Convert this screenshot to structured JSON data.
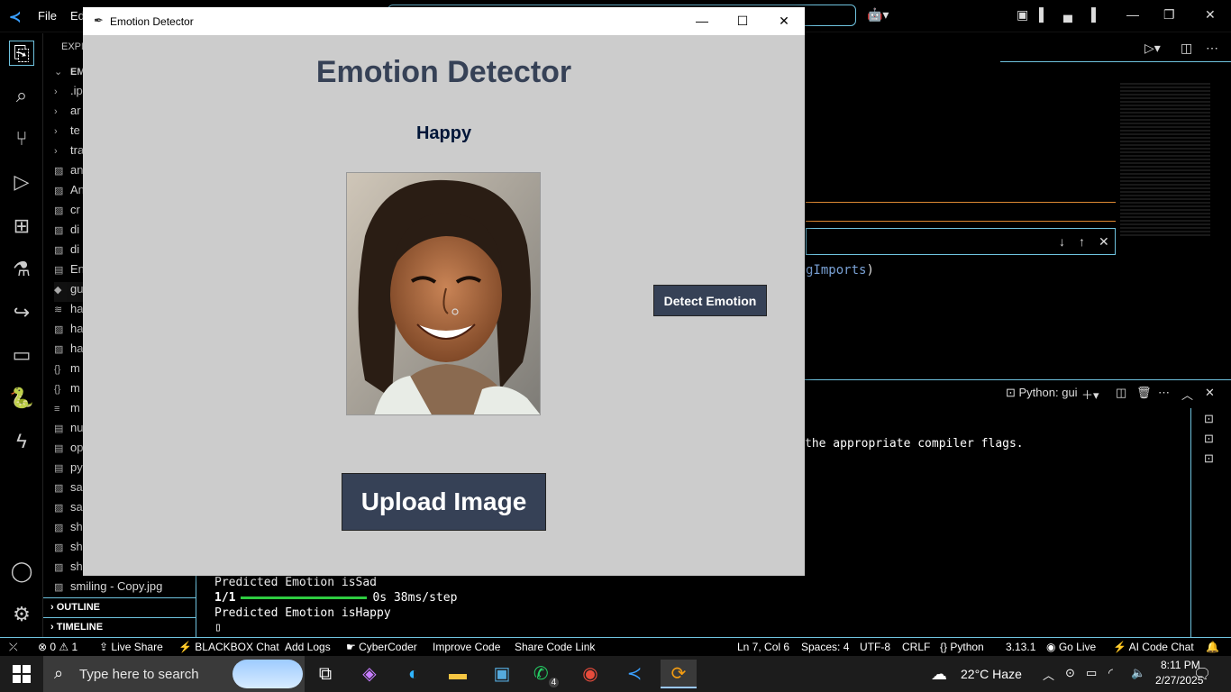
{
  "vscode": {
    "menu": [
      "File",
      "Ed"
    ],
    "explorer_header": "EXPLO",
    "explorer_root": "EMOT",
    "sidebar_items": [
      {
        "icon": "chevron-right-icon",
        "label": ".ip"
      },
      {
        "icon": "chevron-right-icon",
        "label": "ar"
      },
      {
        "icon": "chevron-right-icon",
        "label": "te"
      },
      {
        "icon": "chevron-right-icon",
        "label": "tra"
      },
      {
        "icon": "image-file-icon",
        "label": "an"
      },
      {
        "icon": "image-file-icon",
        "label": "An"
      },
      {
        "icon": "image-file-icon",
        "label": "cr"
      },
      {
        "icon": "image-file-icon",
        "label": "di"
      },
      {
        "icon": "image-file-icon",
        "label": "di"
      },
      {
        "icon": "file-icon",
        "label": "En"
      },
      {
        "icon": "python-file-icon",
        "label": "gu"
      },
      {
        "icon": "rss-icon",
        "label": "ha"
      },
      {
        "icon": "image-file-icon",
        "label": "ha"
      },
      {
        "icon": "image-file-icon",
        "label": "ha"
      },
      {
        "icon": "json-file-icon",
        "label": "m"
      },
      {
        "icon": "json-file-icon",
        "label": "m"
      },
      {
        "icon": "text-file-icon",
        "label": "m"
      },
      {
        "icon": "file-icon",
        "label": "nu"
      },
      {
        "icon": "file-icon",
        "label": "op"
      },
      {
        "icon": "file-icon",
        "label": "py"
      },
      {
        "icon": "image-file-icon",
        "label": "sa"
      },
      {
        "icon": "image-file-icon",
        "label": "sa"
      },
      {
        "icon": "image-file-icon",
        "label": "sh"
      },
      {
        "icon": "image-file-icon",
        "label": "sh"
      },
      {
        "icon": "image-file-icon",
        "label": "sh"
      },
      {
        "icon": "image-file-icon",
        "label": "smiling - Copy.jpg"
      }
    ],
    "outline_label": "OUTLINE",
    "timeline_label": "TIMELINE",
    "code_fragment": "gImports",
    "code_paren": ")",
    "terminal_tab": "Python: gui",
    "terminal_lines": {
      "compiler": "the appropriate compiler flags.",
      "pred_sad": "Predicted Emotion isSad",
      "progress_prefix": "1/1",
      "progress_suffix": "0s 38ms/step",
      "pred_happy": "Predicted Emotion isHappy"
    },
    "status": {
      "problems": "⊗ 0 ⚠ 1",
      "live_share": "Live Share",
      "blackbox": "BLACKBOX Chat",
      "add_logs": "Add Logs",
      "cybercoder": "CyberCoder",
      "improve_code": "Improve Code",
      "share_code": "Share Code Link",
      "position": "Ln 7, Col 6",
      "spaces": "Spaces: 4",
      "encoding": "UTF-8",
      "eol": "CRLF",
      "language": "{} Python",
      "version": "3.13.1",
      "go_live": "Go Live",
      "ai_chat": "AI Code Chat"
    }
  },
  "app": {
    "window_title": "Emotion Detector",
    "heading": "Emotion Detector",
    "emotion_result": "Happy",
    "detect_button": "Detect Emotion",
    "upload_button": "Upload Image",
    "controls": {
      "minimize": "—",
      "maximize": "☐",
      "close": "✕"
    }
  },
  "taskbar": {
    "search_placeholder": "Type here to search",
    "whatsapp_badge": "4",
    "weather": "22°C Haze",
    "time": "8:11 PM",
    "date": "2/27/2025"
  },
  "colors": {
    "app_bg": "#cccccc",
    "button_bg": "#364156",
    "heading": "#364156",
    "result_text": "#011638",
    "accent_border": "#6fc3df",
    "terminal_progress": "#2ecc40"
  }
}
